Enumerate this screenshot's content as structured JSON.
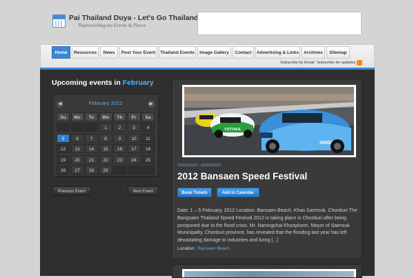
{
  "site": {
    "title": "Pai Thailand Duya - Let's Go Thailand",
    "tagline": "Thaitravelling.net Events & Places",
    "logo_icon": "calendar-icon"
  },
  "nav": {
    "items": [
      {
        "label": "Home",
        "active": true
      },
      {
        "label": "Resources"
      },
      {
        "label": "News"
      },
      {
        "label": "Post Your Event"
      },
      {
        "label": "Thailand Events"
      },
      {
        "label": "Image Gallery"
      },
      {
        "label": "Contact"
      },
      {
        "label": "Advertising & Links"
      },
      {
        "label": "Archives"
      },
      {
        "label": "Sitemap"
      }
    ],
    "subscribe_email": "Subscribe by Email",
    "subscribe_updates": "Subscribe for updates",
    "rss_icon": "rss-icon"
  },
  "sidebar": {
    "heading_prefix": "Upcoming events in",
    "heading_month": "February",
    "calendar": {
      "title": "February 2012",
      "prev_icon": "chevron-left-icon",
      "next_icon": "chevron-right-icon",
      "weekdays": [
        "Su",
        "Mo",
        "Tu",
        "We",
        "Th",
        "Fr",
        "Sa"
      ],
      "weeks": [
        [
          "",
          "",
          "",
          "1",
          "2",
          "3",
          "4"
        ],
        [
          "5",
          "6",
          "7",
          "8",
          "9",
          "10",
          "11"
        ],
        [
          "12",
          "13",
          "14",
          "15",
          "16",
          "17",
          "18"
        ],
        [
          "19",
          "20",
          "21",
          "22",
          "23",
          "24",
          "25"
        ],
        [
          "26",
          "27",
          "28",
          "29",
          "",
          "",
          ""
        ]
      ],
      "selected_day": "5"
    },
    "prev_button": "Previous Event",
    "next_button": "Next Event"
  },
  "event": {
    "date_range": "02/01/2012 - 02/05/2012",
    "title": "2012 Bansaen Speed Festival",
    "book_button": "Book Tickets",
    "calendar_button": "Add to Calendar",
    "description": "Date: 1 – 5 February, 2012 Location: Bansaen Beach, Khao Sammuk, Chonburi The Bangsaen Thailand Speed Festival 2012 is taking place in Chonburi after being postponed due to the flood crisis. Mr. Narongchai Khunpluem, Mayor of Saensuk Municipality, Chonburi province, has revealed that the flooding last year has left devastating damage to industries and living [...]",
    "location_label": "Location :",
    "location_value": "Bansaen Beach",
    "photo_text_left": "YOTTAKA",
    "photo_text_right": "SINGHA"
  },
  "colors": {
    "accent": "#3b87d4",
    "link": "#5aaef0",
    "panel": "#2f2f2f",
    "card": "#3a3a3a"
  }
}
